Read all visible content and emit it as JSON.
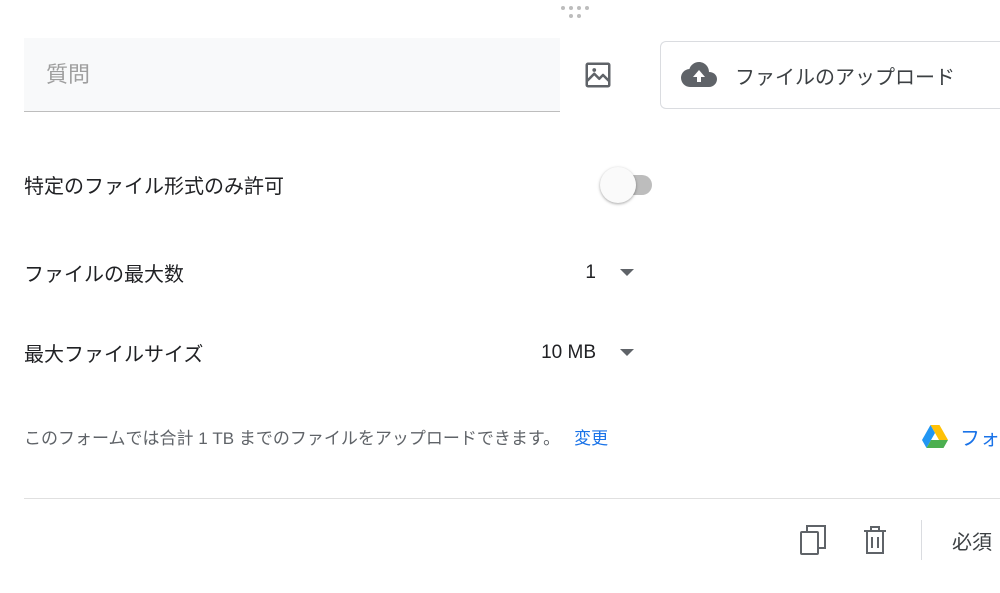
{
  "question": {
    "placeholder": "質問"
  },
  "typeSelector": {
    "label": "ファイルのアップロード"
  },
  "settings": {
    "fileTypeRestrict": {
      "label": "特定のファイル形式のみ許可",
      "value": false
    },
    "maxFiles": {
      "label": "ファイルの最大数",
      "value": "1"
    },
    "maxSize": {
      "label": "最大ファイルサイズ",
      "value": "10 MB"
    }
  },
  "info": {
    "text": "このフォームでは合計 1 TB までのファイルをアップロードできます。",
    "changeLink": "変更"
  },
  "driveLink": {
    "label": "フォ"
  },
  "footer": {
    "required": "必須"
  }
}
